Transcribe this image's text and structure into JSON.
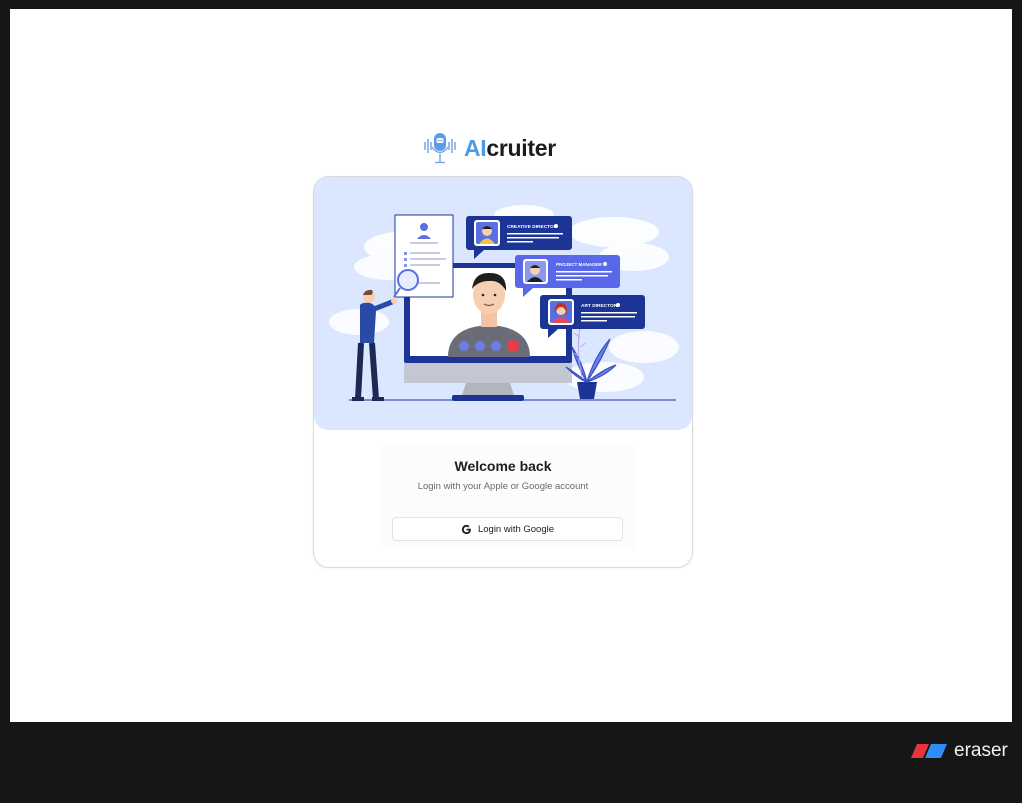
{
  "app": {
    "logo_ai": "AI",
    "logo_rest": "cruiter"
  },
  "illustration": {
    "cards": [
      {
        "title": "CREATIVE DIRECTOR"
      },
      {
        "title": "PROJECT MANAGER"
      },
      {
        "title": "ART DIRECTOR"
      }
    ]
  },
  "login": {
    "heading": "Welcome back",
    "subtitle": "Login with your Apple or Google account",
    "google_button": "Login with Google"
  },
  "watermark": {
    "brand": "eraser"
  },
  "colors": {
    "accent": "#4b9be8",
    "illustration_bg": "#dbe6ff",
    "navy": "#1d3497",
    "page_bg": "#161616"
  }
}
